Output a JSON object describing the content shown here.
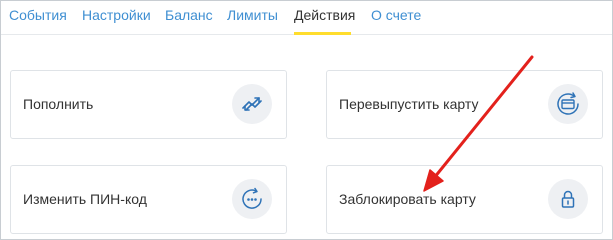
{
  "tabs": [
    {
      "label": "События"
    },
    {
      "label": "Настройки"
    },
    {
      "label": "Баланс"
    },
    {
      "label": "Лимиты"
    },
    {
      "label": "Действия"
    },
    {
      "label": "О счете"
    }
  ],
  "active_tab": "Действия",
  "actions": [
    {
      "label": "Пополнить",
      "icon": "transfer-arrows-icon"
    },
    {
      "label": "Перевыпустить карту",
      "icon": "card-reissue-icon"
    },
    {
      "label": "Изменить ПИН-код",
      "icon": "pin-change-icon"
    },
    {
      "label": "Заблокировать карту",
      "icon": "lock-icon"
    }
  ],
  "colors": {
    "tab_link": "#3f8fd2",
    "tab_active": "#333333",
    "active_underline": "#ffdd2d",
    "icon_bg": "#eef0f3",
    "icon_stroke": "#2f73b7",
    "annotation_arrow": "#e3211c"
  }
}
